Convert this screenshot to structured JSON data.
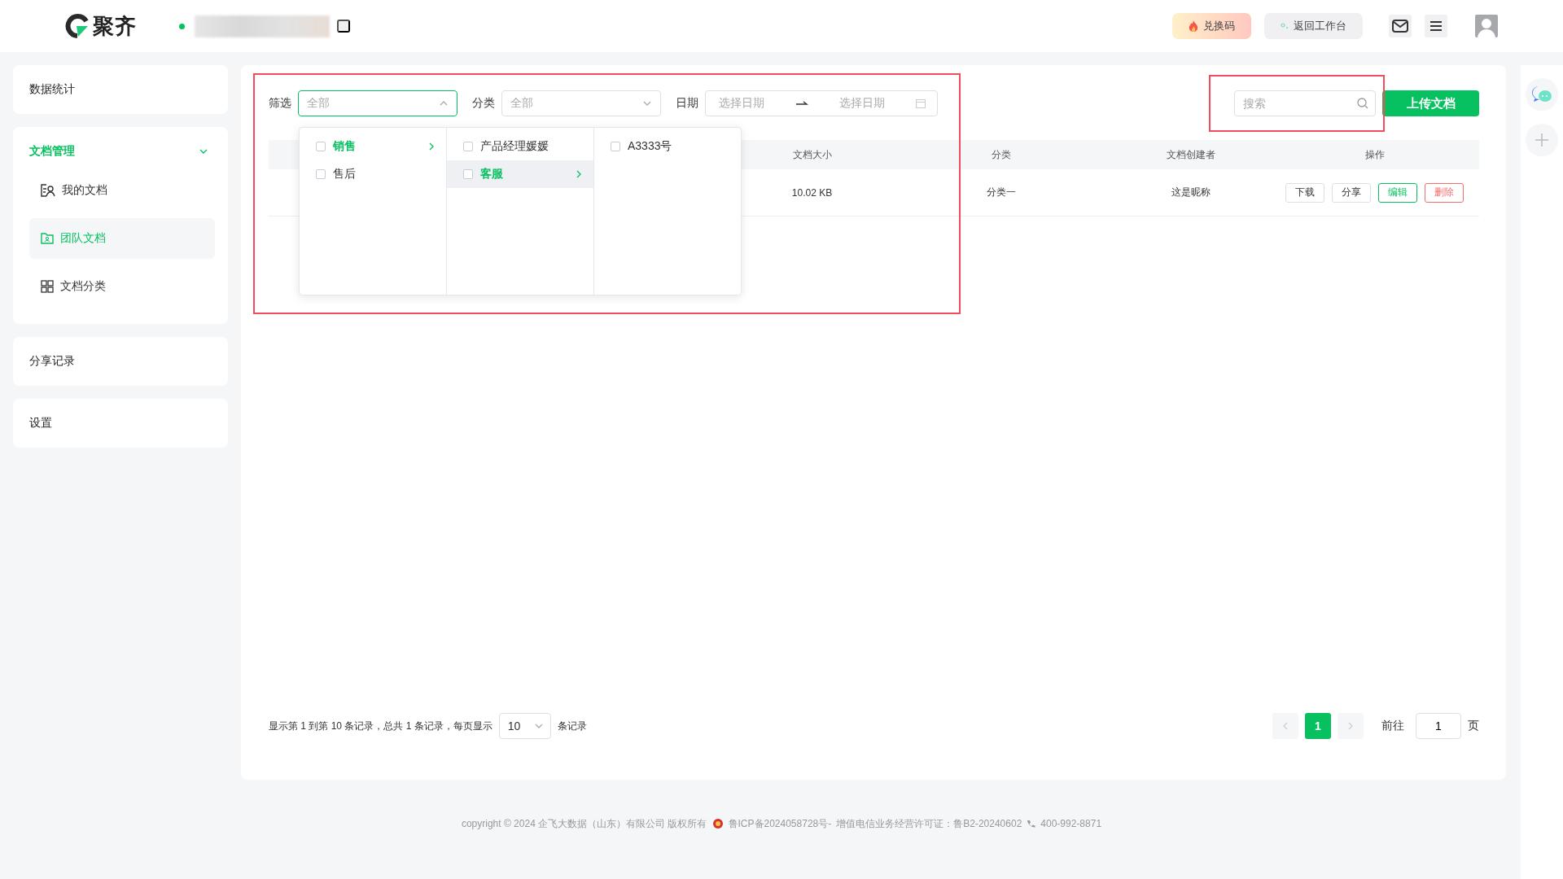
{
  "brand": {
    "name": "聚齐"
  },
  "topbar": {
    "buttons": [
      {
        "label": "兑换码",
        "kind": "promo"
      },
      {
        "label": "返回工作台",
        "kind": "plain"
      }
    ]
  },
  "sidebar": {
    "items": [
      {
        "label": "数据统计",
        "kind": "link"
      },
      {
        "label": "文档管理",
        "kind": "group",
        "expanded": true,
        "children": [
          {
            "label": "我的文档",
            "selected": false
          },
          {
            "label": "团队文档",
            "selected": true
          },
          {
            "label": "文档分类",
            "selected": false
          }
        ]
      },
      {
        "label": "分享记录",
        "kind": "link"
      },
      {
        "label": "设置",
        "kind": "link"
      }
    ]
  },
  "filters": [
    {
      "label": "筛选",
      "placeholder": "全部",
      "open": true
    },
    {
      "label": "分类",
      "placeholder": "全部",
      "open": false
    }
  ],
  "date_range": {
    "label": "日期",
    "start_placeholder": "选择日期",
    "end_placeholder": "选择日期"
  },
  "cascader": {
    "columns": [
      {
        "items": [
          {
            "label": "销售",
            "checked": false,
            "selected": true,
            "hovered": false,
            "has_children": true
          },
          {
            "label": "售后",
            "checked": false,
            "selected": false,
            "hovered": false,
            "has_children": false
          }
        ]
      },
      {
        "items": [
          {
            "label": "产品经理媛媛",
            "checked": false,
            "selected": false,
            "hovered": false,
            "has_children": false
          },
          {
            "label": "客服",
            "checked": false,
            "selected": true,
            "hovered": true,
            "has_children": true
          }
        ]
      },
      {
        "items": [
          {
            "label": "A3333号",
            "checked": false,
            "selected": false,
            "hovered": false,
            "has_children": false
          }
        ]
      }
    ]
  },
  "search": {
    "placeholder": "搜索"
  },
  "upload_button": "上传文档",
  "table": {
    "columns": [
      "文档大小",
      "分类",
      "文档创建者",
      "操作"
    ],
    "rows": [
      {
        "cells": [
          "10.02 KB",
          "分类一",
          "这是昵称"
        ],
        "actions": [
          {
            "label": "下载",
            "kind": "default"
          },
          {
            "label": "分享",
            "kind": "default"
          },
          {
            "label": "编辑",
            "kind": "primary"
          },
          {
            "label": "删除",
            "kind": "danger"
          }
        ]
      }
    ]
  },
  "pagination": {
    "summary": "显示第 1 到第 10 条记录，总共 1 条记录，每页显示",
    "page_size": "10",
    "suffix": "条记录",
    "pages": [
      {
        "label": "1",
        "selected": true
      }
    ],
    "goto_label": "前往",
    "goto_value": "1",
    "page_unit": "页"
  },
  "footer": {
    "copyright": "copyright © 2024 企飞大数据（山东）有限公司 版权所有",
    "icp": "鲁ICP备2024058728号-",
    "license": "增值电信业务经营许可证：鲁B2-20240602",
    "phone": "400-992-8871"
  }
}
